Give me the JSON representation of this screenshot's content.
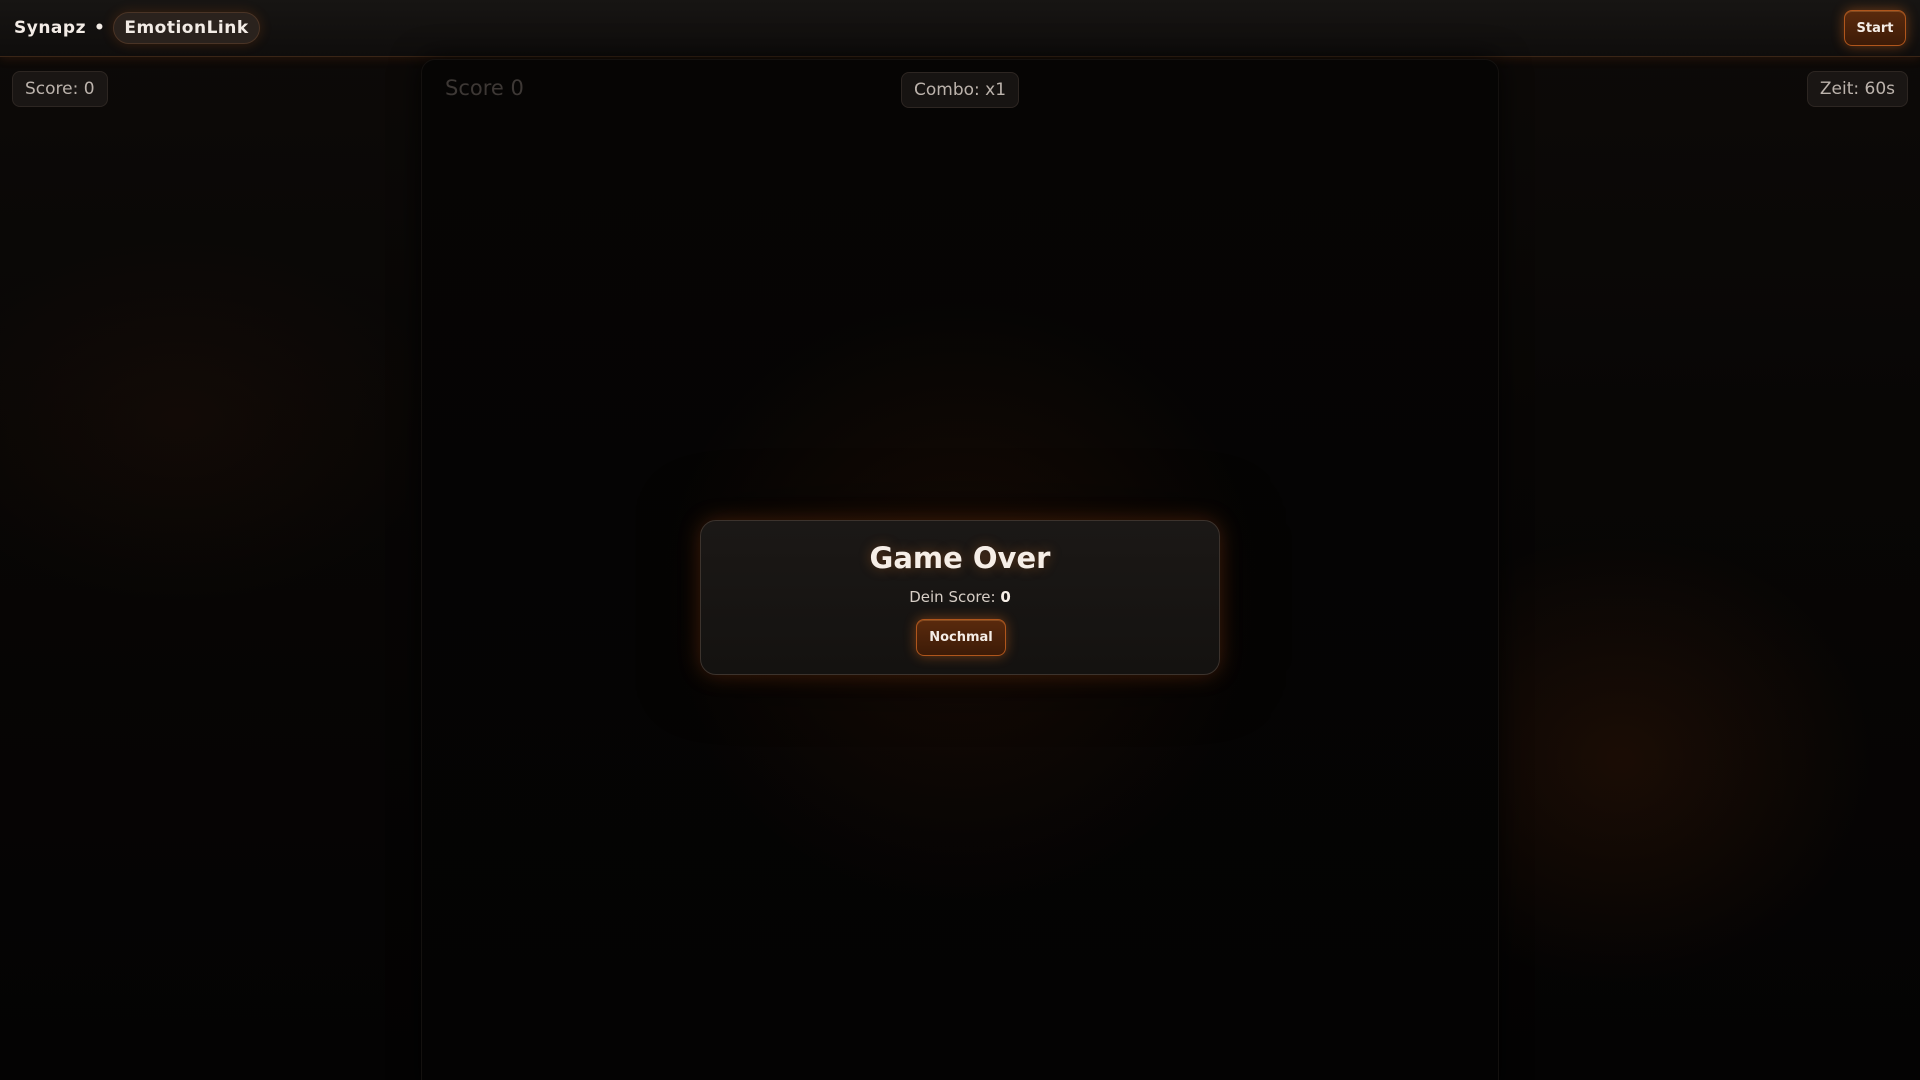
{
  "header": {
    "brand": "Synapz",
    "separator": "•",
    "game_name": "EmotionLink",
    "start_label": "Start"
  },
  "hud": {
    "score_label": "Score: 0",
    "combo_label": "Combo: x1",
    "time_label": "Zeit: 60s",
    "field_score": "Score 0"
  },
  "modal": {
    "title": "Game Over",
    "score_prefix": "Dein Score:",
    "score_value": "0",
    "again_label": "Nochmal"
  },
  "colors": {
    "accent": "#b0561c",
    "background": "#050403",
    "text": "#f3ece6"
  }
}
